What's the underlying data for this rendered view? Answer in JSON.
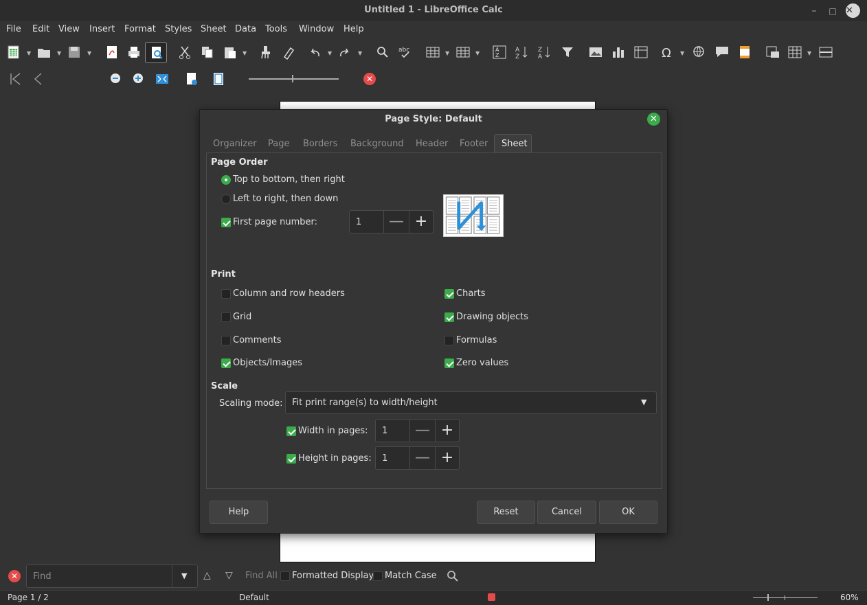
{
  "window": {
    "title": "Untitled 1 - LibreOffice Calc"
  },
  "menu": [
    "File",
    "Edit",
    "View",
    "Insert",
    "Format",
    "Styles",
    "Sheet",
    "Data",
    "Tools",
    "Window",
    "Help"
  ],
  "dialog": {
    "title": "Page Style: Default",
    "tabs": [
      "Organizer",
      "Page",
      "Borders",
      "Background",
      "Header",
      "Footer",
      "Sheet"
    ],
    "active_tab": "Sheet",
    "page_order": {
      "heading": "Page Order",
      "option_top_bottom": "Top to bottom, then right",
      "option_left_right": "Left to right, then down",
      "selected": "Top to bottom, then right",
      "first_page_number_label": "First page number:",
      "first_page_number_checked": true,
      "first_page_number_value": "1"
    },
    "print": {
      "heading": "Print",
      "items": [
        {
          "label": "Column and row headers",
          "checked": false
        },
        {
          "label": "Grid",
          "checked": false
        },
        {
          "label": "Comments",
          "checked": false
        },
        {
          "label": "Objects/Images",
          "checked": true
        },
        {
          "label": "Charts",
          "checked": true
        },
        {
          "label": "Drawing objects",
          "checked": true
        },
        {
          "label": "Formulas",
          "checked": false
        },
        {
          "label": "Zero values",
          "checked": true
        }
      ]
    },
    "scale": {
      "heading": "Scale",
      "mode_label": "Scaling mode:",
      "mode_value": "Fit print range(s) to width/height",
      "width_label": "Width in pages:",
      "width_checked": true,
      "width_value": "1",
      "height_label": "Height in pages:",
      "height_checked": true,
      "height_value": "1"
    },
    "buttons": {
      "help": "Help",
      "reset": "Reset",
      "cancel": "Cancel",
      "ok": "OK"
    }
  },
  "findbar": {
    "placeholder": "Find",
    "find_all": "Find All",
    "formatted_display": "Formatted Display",
    "match_case": "Match Case"
  },
  "status": {
    "page": "Page 1 / 2",
    "style": "Default",
    "zoom": "60%"
  },
  "colors": {
    "accent_green": "#3bab4b",
    "background": "#333333",
    "close_red": "#e54b4b",
    "icon_blue": "#2f8fd8"
  }
}
